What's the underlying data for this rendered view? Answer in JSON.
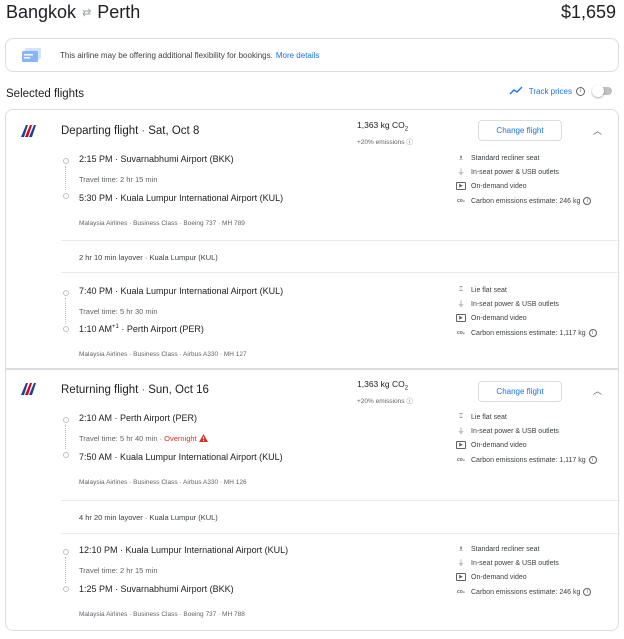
{
  "header": {
    "origin": "Bangkok",
    "destination": "Perth",
    "price": "$1,659"
  },
  "banner": {
    "text": "This airline may be offering additional flexibility for bookings.",
    "link": "More details"
  },
  "selected_title": "Selected flights",
  "track_prices": {
    "label": "Track prices",
    "enabled": false
  },
  "departing": {
    "title": "Departing flight",
    "date": "Sat, Oct 8",
    "co2": "1,363 kg CO",
    "co2_sub": "2",
    "emissions_delta": "+20% emissions",
    "change_label": "Change flight",
    "segments": [
      {
        "dep_time": "2:15 PM",
        "dep_airport": "Suvarnabhumi Airport (BKK)",
        "travel_time": "Travel time: 2 hr 15 min",
        "arr_time": "5:30 PM",
        "arr_sup": "",
        "arr_airport": "Kuala Lumpur International Airport (KUL)",
        "details": "Malaysia Airlines · Business Class · Boeing 737 · MH 789",
        "amenities": [
          "Standard recliner seat",
          "In-seat power & USB outlets",
          "On-demand video",
          "Carbon emissions estimate: 246 kg"
        ]
      },
      {
        "dep_time": "7:40 PM",
        "dep_airport": "Kuala Lumpur International Airport (KUL)",
        "travel_time": "Travel time: 5 hr 30 min",
        "arr_time": "1:10 AM",
        "arr_sup": "+1",
        "arr_airport": "Perth Airport (PER)",
        "details": "Malaysia Airlines · Business Class · Airbus A330 · MH 127",
        "amenities": [
          "Lie flat seat",
          "In-seat power & USB outlets",
          "On-demand video",
          "Carbon emissions estimate: 1,117 kg"
        ]
      }
    ],
    "layover": "2 hr 10 min layover · Kuala Lumpur (KUL)"
  },
  "returning": {
    "title": "Returning flight",
    "date": "Sun, Oct 16",
    "co2": "1,363 kg CO",
    "co2_sub": "2",
    "emissions_delta": "+20% emissions",
    "change_label": "Change flight",
    "segments": [
      {
        "dep_time": "2:10 AM",
        "dep_airport": "Perth Airport (PER)",
        "travel_time": "Travel time: 5 hr 40 min",
        "overnight": "Overnight",
        "arr_time": "7:50 AM",
        "arr_sup": "",
        "arr_airport": "Kuala Lumpur International Airport (KUL)",
        "details": "Malaysia Airlines · Business Class · Airbus A330 · MH 126",
        "amenities": [
          "Lie flat seat",
          "In-seat power & USB outlets",
          "On-demand video",
          "Carbon emissions estimate: 1,117 kg"
        ]
      },
      {
        "dep_time": "12:10 PM",
        "dep_airport": "Kuala Lumpur International Airport (KUL)",
        "travel_time": "Travel time: 2 hr 15 min",
        "arr_time": "1:25 PM",
        "arr_sup": "",
        "arr_airport": "Suvarnabhumi Airport (BKK)",
        "details": "Malaysia Airlines · Business Class · Boeing 737 · MH 788",
        "amenities": [
          "Standard recliner seat",
          "In-seat power & USB outlets",
          "On-demand video",
          "Carbon emissions estimate: 246 kg"
        ]
      }
    ],
    "layover": "4 hr 20 min layover · Kuala Lumpur (KUL)"
  },
  "colors": {
    "accent": "#1a73e8",
    "warning": "#d93025",
    "airline_red": "#d6001c",
    "airline_blue": "#1c3f94"
  },
  "icons": [
    "swap-arrows-icon",
    "flexibility-icon",
    "track-prices-icon",
    "info-icon",
    "malaysia-airlines-logo",
    "chevron-up-icon",
    "seat-icon",
    "power-outlet-icon",
    "video-icon",
    "co2-icon",
    "warning-icon"
  ]
}
